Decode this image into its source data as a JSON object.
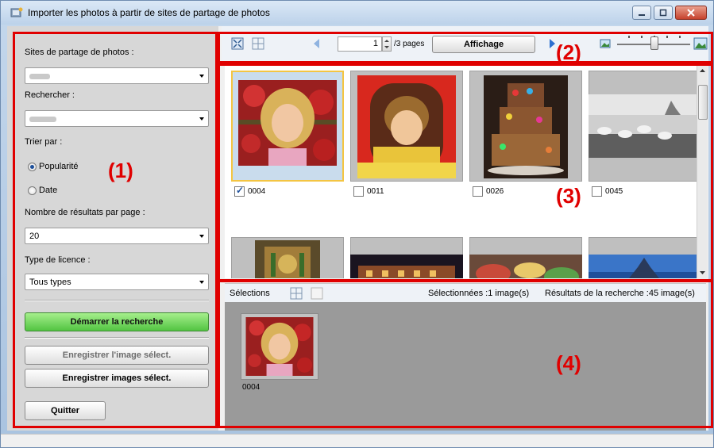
{
  "window": {
    "title": "Importer les photos à partir de sites de partage de photos",
    "title_icon": "photo-import-app-icon",
    "controls": [
      "minimize-icon",
      "maximize-icon",
      "close-icon"
    ]
  },
  "left_panel": {
    "sites_label": "Sites de partage de photos :",
    "search_label": "Rechercher :",
    "sort_label": "Trier par :",
    "sort_options": [
      {
        "label": "Popularité",
        "selected": true
      },
      {
        "label": "Date",
        "selected": false
      }
    ],
    "results_label": "Nombre de résultats par page :",
    "results_value": "20",
    "license_label": "Type de licence :",
    "license_value": "Tous types",
    "start_search_button": "Démarrer la recherche",
    "save_one_button": "Enregistrer l'image sélect.",
    "save_many_button": "Enregistrer images sélect.",
    "quit_button": "Quitter"
  },
  "toolbar": {
    "page_value": "1",
    "pages_label": "/3 pages",
    "display_button": "Affichage",
    "icons": [
      "fit-view-icon",
      "grid-view-icon",
      "prev-page-icon",
      "next-page-icon",
      "small-thumbnail-icon",
      "large-thumbnail-icon"
    ]
  },
  "thumbnails": [
    {
      "id": "0004",
      "checked": true,
      "selected": true
    },
    {
      "id": "0011",
      "checked": false,
      "selected": false
    },
    {
      "id": "0026",
      "checked": false,
      "selected": false
    },
    {
      "id": "0045",
      "checked": false,
      "selected": false
    }
  ],
  "selection_bar": {
    "label": "Sélections",
    "selected_status": "Sélectionnées :1 image(s)",
    "results_status": "Résultats de la recherche :45 image(s)"
  },
  "selected_items": [
    {
      "id": "0004"
    }
  ],
  "callouts": [
    "(1)",
    "(2)",
    "(3)",
    "(4)"
  ],
  "colors": {
    "annotation_red": "#e00000",
    "accent_green": "#52c442",
    "selection_yellow": "#f4c542"
  }
}
